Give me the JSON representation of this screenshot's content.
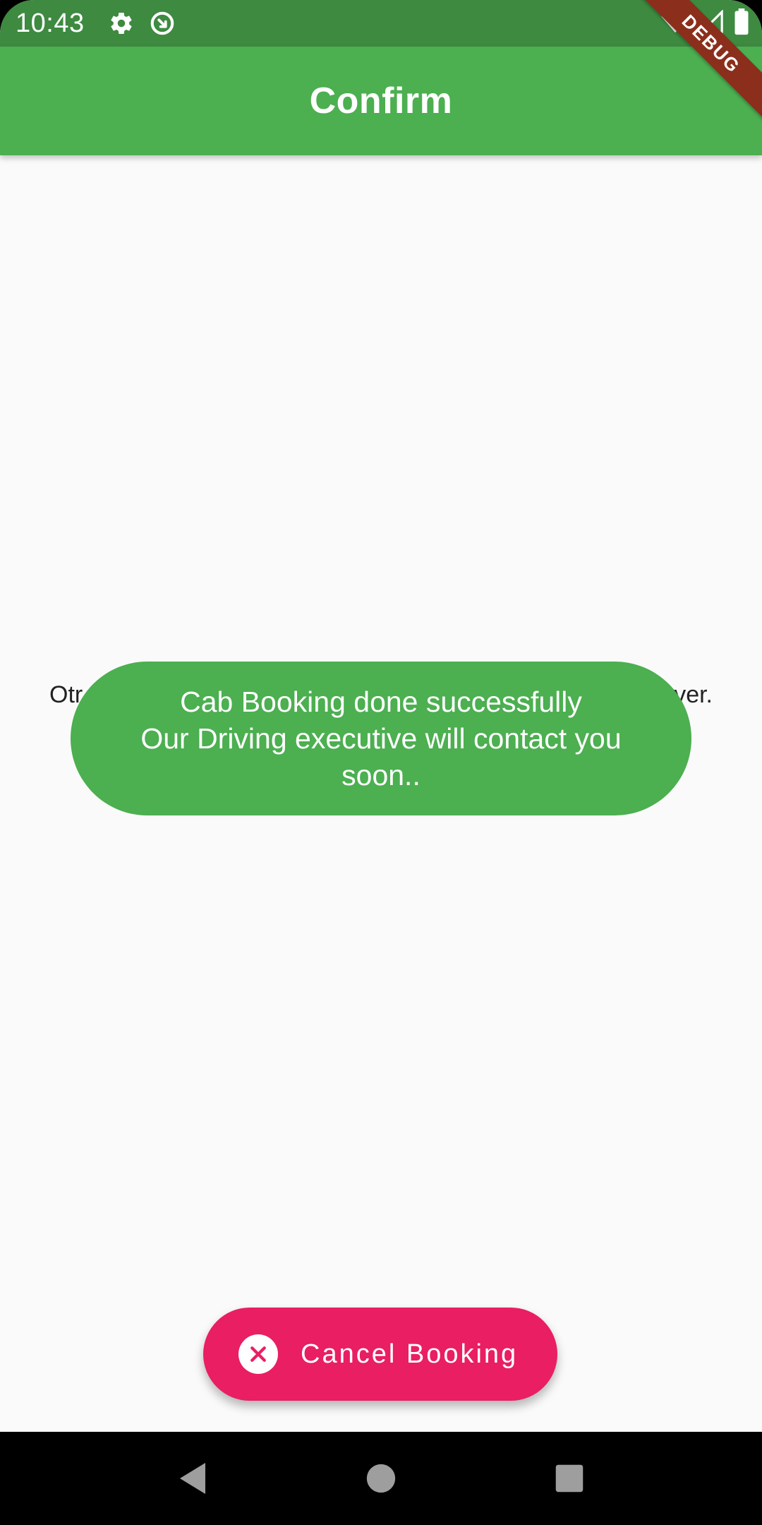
{
  "status_bar": {
    "time": "10:43",
    "icons": [
      "settings-icon",
      "sync-icon",
      "wifi-icon",
      "signal-icon",
      "battery-icon"
    ]
  },
  "debug_banner": "DEBUG",
  "app_bar": {
    "title": "Confirm"
  },
  "body": {
    "text_left_fragment": "Otr",
    "text_right_fragment": "ver."
  },
  "toast": {
    "line1": "Cab Booking done successfully",
    "line2": "Our Driving executive will contact you",
    "line3": "soon.."
  },
  "cancel_button": {
    "label": "Cancel Booking",
    "icon": "close-circle-icon"
  },
  "nav_bar": {
    "buttons": [
      "back-icon",
      "home-icon",
      "recents-icon"
    ]
  },
  "colors": {
    "status_bar": "#3d8a40",
    "app_bar": "#4caf50",
    "toast": "#4caf50",
    "cancel_button": "#e91e63",
    "debug_banner": "#8b2e1c"
  }
}
